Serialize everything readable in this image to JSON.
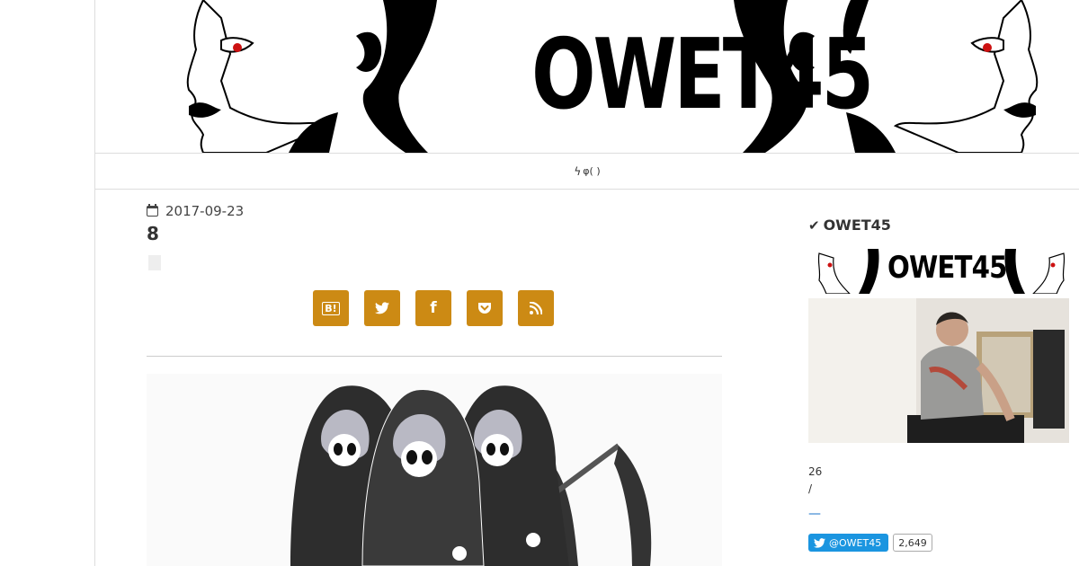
{
  "banner": {
    "logo_text": "OWET45"
  },
  "nav": {
    "bolt_icon": "bolt-icon",
    "text": "φ( )"
  },
  "post": {
    "date": "2017-09-23",
    "title": "8"
  },
  "share": {
    "buttons": [
      {
        "name": "hatena-bookmark-button",
        "label": "B!"
      },
      {
        "name": "twitter-share-button",
        "icon": "twitter-icon"
      },
      {
        "name": "facebook-share-button",
        "label": "f"
      },
      {
        "name": "pocket-share-button",
        "icon": "pocket-icon"
      },
      {
        "name": "rss-feed-button",
        "icon": "rss-icon"
      }
    ],
    "accent": "#cc8a14"
  },
  "sidebar": {
    "title": "OWET45",
    "mini_logo_text": "OWET45",
    "text1": "26",
    "text2": "/",
    "link": "—",
    "twitter_handle": "@OWET45",
    "twitter_followers": "2,649",
    "twitter_color": "#1b95e0"
  }
}
